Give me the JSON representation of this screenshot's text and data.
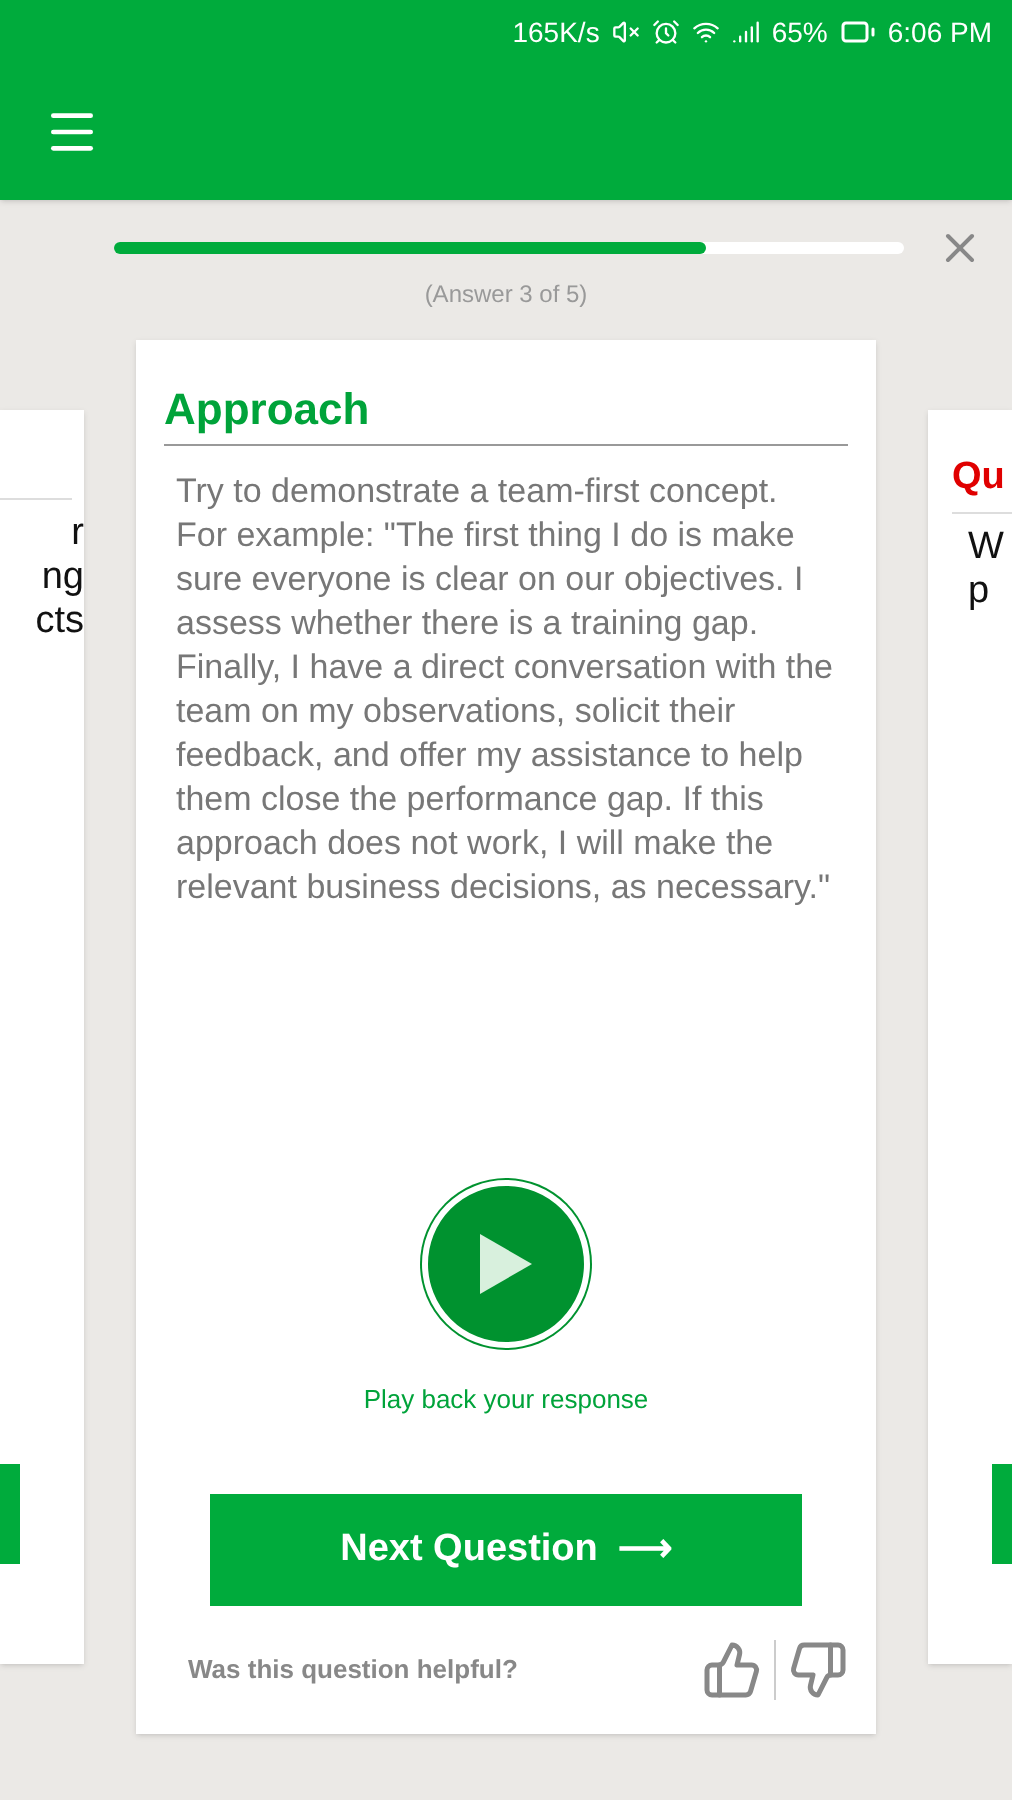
{
  "status_bar": {
    "speed": "165K/s",
    "battery": "65%",
    "time": "6:06 PM"
  },
  "progress": {
    "level": 0.75,
    "caption": "(Answer 3 of 5)"
  },
  "left_card": {
    "lines": [
      "r",
      "ng",
      "cts"
    ]
  },
  "card": {
    "title": "Approach",
    "body": "Try to demonstrate a team-first concept. For example: \"The first thing I do is make sure everyone is clear on our objectives. I assess whether there is a training gap. Finally, I have a direct conversation with the team on my observations, solicit their feedback, and offer my assistance to help them close the performance gap. If this approach does not work, I will make the relevant business decisions, as necessary.\"",
    "play_label": "Play back your response",
    "next_button": "Next Question",
    "next_arrow": "⟶",
    "helpful_prompt": "Was this question helpful?"
  },
  "right_card": {
    "title": "Qu",
    "lines": [
      "W",
      "p"
    ]
  }
}
